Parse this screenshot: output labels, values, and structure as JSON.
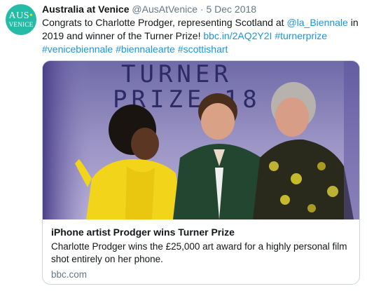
{
  "tweet": {
    "avatar": {
      "line1": "AUS",
      "line1_dot": "•",
      "line2": "VENICE"
    },
    "author_name": "Australia at Venice",
    "handle": "@AusAtVenice",
    "separator": "·",
    "date": "5 Dec 2018",
    "text_1": "Congrats to Charlotte Prodger, representing Scotland at ",
    "mention": "@la_Biennale",
    "text_2": " in 2019 and winner of the Turner Prize! ",
    "url": "bbc.in/2AQ2Y2I",
    "hashtag_1": "#turnerprize",
    "hashtag_2": "#venicebiennale",
    "hashtag_3": "#biennalearte",
    "hashtag_4": "#scottishart"
  },
  "card": {
    "backdrop_line1": "TURNER",
    "backdrop_line2": "PRIZE.18",
    "title": "iPhone artist Prodger wins Turner Prize",
    "description": "Charlotte Prodger wins the £25,000 art award for a highly personal film shot entirely on her phone.",
    "domain": "bbc.com"
  },
  "colors": {
    "link": "#1b95e0",
    "avatar_bg": "#25bba6",
    "text": "#14171a",
    "muted": "#657786",
    "card_border": "#ccd6dd"
  }
}
